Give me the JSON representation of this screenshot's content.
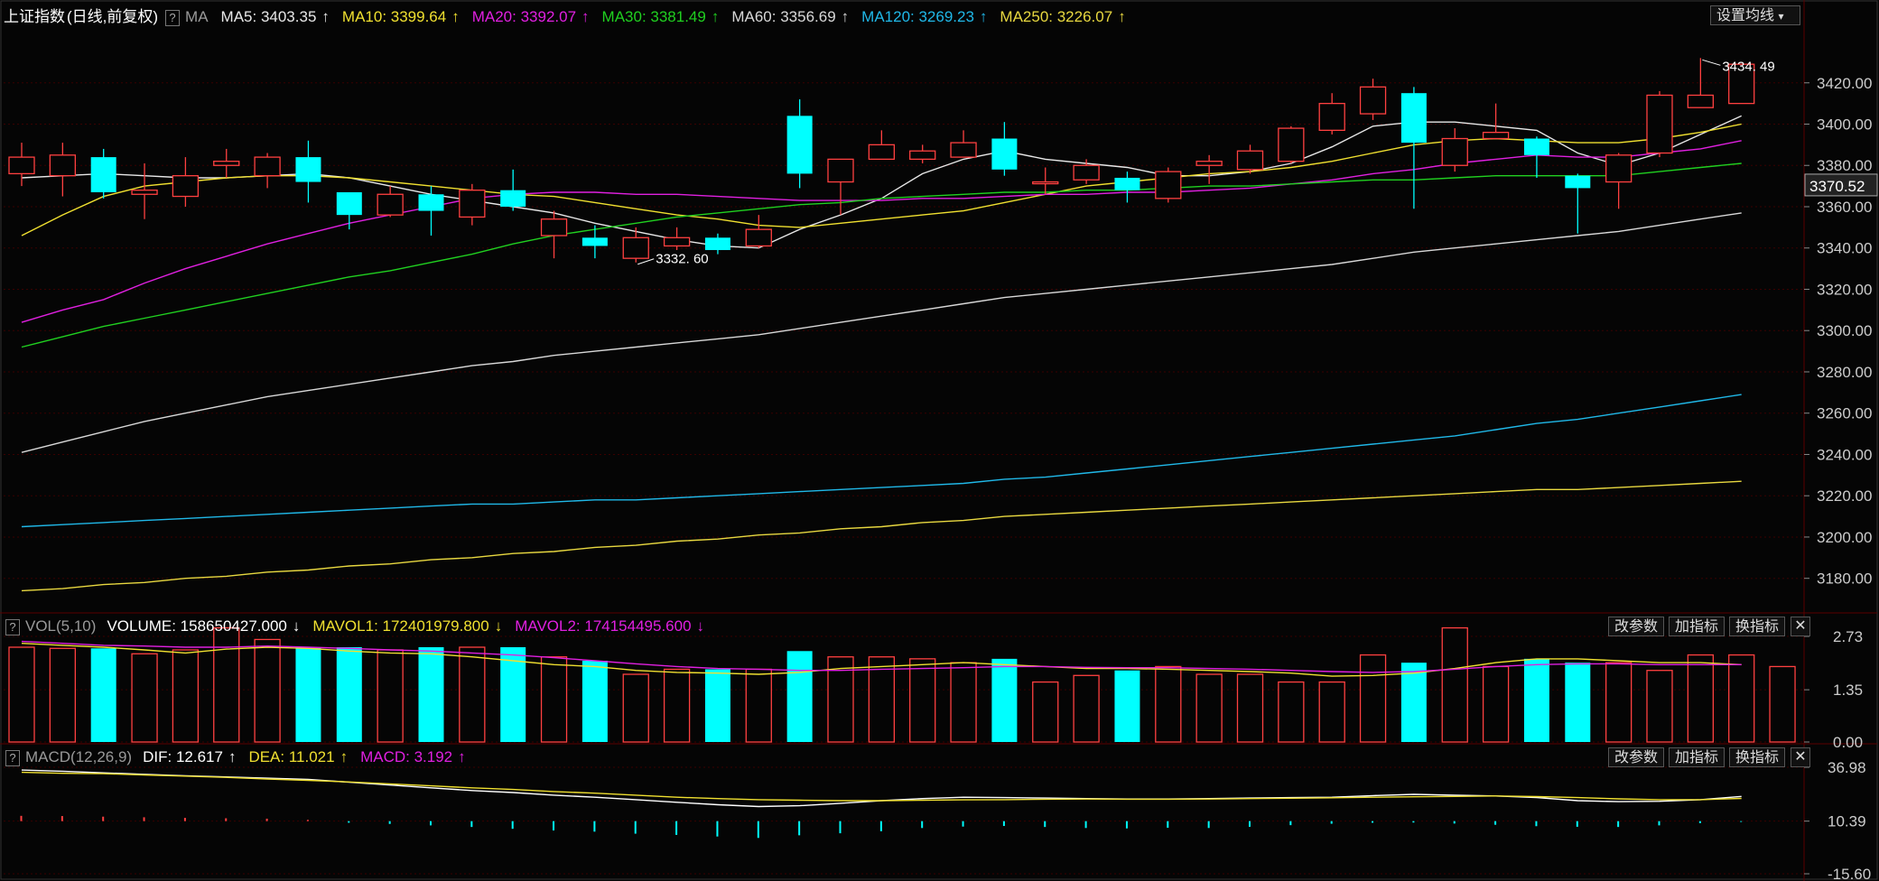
{
  "main_panel": {
    "title": "上证指数",
    "subtitle": "(日线,前复权)",
    "help": "?",
    "indicator": "MA",
    "ma_items": [
      {
        "label": "MA5: 3403.35",
        "arrow": "↑",
        "color": "#e8e8e8"
      },
      {
        "label": "MA10: 3399.64",
        "arrow": "↑",
        "color": "#f0e030"
      },
      {
        "label": "MA20: 3392.07",
        "arrow": "↑",
        "color": "#e020e0"
      },
      {
        "label": "MA30: 3381.49",
        "arrow": "↑",
        "color": "#20d020"
      },
      {
        "label": "MA60: 3356.69",
        "arrow": "↑",
        "color": "#d8d8d8"
      },
      {
        "label": "MA120: 3269.23",
        "arrow": "↑",
        "color": "#20b8e8"
      },
      {
        "label": "MA250: 3226.07",
        "arrow": "↑",
        "color": "#e8d840"
      }
    ],
    "settings_button": "设置均线",
    "settings_caret": "▾",
    "price_ticks": [
      "3420.00",
      "3400.00",
      "3380.00",
      "3360.00",
      "3340.00",
      "3320.00",
      "3300.00",
      "3280.00",
      "3260.00",
      "3240.00",
      "3220.00",
      "3200.00",
      "3180.00"
    ],
    "current_price": "3370.52",
    "high_marker": "3434. 49",
    "low_marker": "3332. 60"
  },
  "volume_panel": {
    "help": "?",
    "indicator": "VOL(5,10)",
    "items": [
      {
        "label": "VOLUME: 158650427.000",
        "arrow": "↓",
        "color": "#ffffff"
      },
      {
        "label": "MAVOL1: 172401979.800",
        "arrow": "↓",
        "color": "#f0e030"
      },
      {
        "label": "MAVOL2: 174154495.600",
        "arrow": "↓",
        "color": "#e020e0"
      }
    ],
    "buttons": [
      "改参数",
      "加指标",
      "换指标"
    ],
    "close": "✕",
    "ticks": [
      "2.73",
      "1.35",
      "0.00"
    ]
  },
  "macd_panel": {
    "help": "?",
    "indicator": "MACD(12,26,9)",
    "items": [
      {
        "label": "DIF: 12.617",
        "arrow": "↑",
        "color": "#ffffff"
      },
      {
        "label": "DEA: 11.021",
        "arrow": "↑",
        "color": "#f0e030"
      },
      {
        "label": "MACD: 3.192",
        "arrow": "↑",
        "color": "#e020e0"
      }
    ],
    "buttons": [
      "改参数",
      "加指标",
      "换指标"
    ],
    "close": "✕",
    "ticks": [
      "36.98",
      "10.39",
      "-15.60"
    ]
  },
  "colors": {
    "up": "#ff4040",
    "down": "#00ffff",
    "grid": "#3a0000"
  },
  "chart_data": [
    {
      "type": "candlestick",
      "price_range": [
        3165,
        3447
      ],
      "candles": [
        {
          "o": 3376,
          "c": 3384,
          "h": 3391,
          "l": 3370
        },
        {
          "o": 3375,
          "c": 3385,
          "h": 3391,
          "l": 3365
        },
        {
          "o": 3384,
          "c": 3367,
          "h": 3388,
          "l": 3364
        },
        {
          "o": 3366,
          "c": 3368,
          "h": 3381,
          "l": 3354
        },
        {
          "o": 3365,
          "c": 3375,
          "h": 3384,
          "l": 3360
        },
        {
          "o": 3380,
          "c": 3382,
          "h": 3388,
          "l": 3374
        },
        {
          "o": 3375,
          "c": 3384,
          "h": 3386,
          "l": 3369
        },
        {
          "o": 3384,
          "c": 3372,
          "h": 3392,
          "l": 3362
        },
        {
          "o": 3367,
          "c": 3356,
          "h": 3367,
          "l": 3349
        },
        {
          "o": 3356,
          "c": 3366,
          "h": 3370,
          "l": 3355
        },
        {
          "o": 3366,
          "c": 3358,
          "h": 3370,
          "l": 3346
        },
        {
          "o": 3355,
          "c": 3368,
          "h": 3371,
          "l": 3351
        },
        {
          "o": 3368,
          "c": 3360,
          "h": 3378,
          "l": 3358
        },
        {
          "o": 3346,
          "c": 3354,
          "h": 3358,
          "l": 3335
        },
        {
          "o": 3345,
          "c": 3341,
          "h": 3351,
          "l": 3335
        },
        {
          "o": 3335,
          "c": 3345,
          "h": 3350,
          "l": 3333
        },
        {
          "o": 3341,
          "c": 3345,
          "h": 3350,
          "l": 3339
        },
        {
          "o": 3345,
          "c": 3339,
          "h": 3347,
          "l": 3337
        },
        {
          "o": 3341,
          "c": 3349,
          "h": 3356,
          "l": 3340
        },
        {
          "o": 3404,
          "c": 3376,
          "h": 3412,
          "l": 3369
        },
        {
          "o": 3372,
          "c": 3383,
          "h": 3383,
          "l": 3356
        },
        {
          "o": 3383,
          "c": 3390,
          "h": 3397,
          "l": 3383
        },
        {
          "o": 3383,
          "c": 3387,
          "h": 3390,
          "l": 3381
        },
        {
          "o": 3384,
          "c": 3391,
          "h": 3397,
          "l": 3384
        },
        {
          "o": 3393,
          "c": 3378,
          "h": 3401,
          "l": 3375
        },
        {
          "o": 3372,
          "c": 3372,
          "h": 3379,
          "l": 3366
        },
        {
          "o": 3373,
          "c": 3380,
          "h": 3383,
          "l": 3371
        },
        {
          "o": 3374,
          "c": 3368,
          "h": 3377,
          "l": 3362
        },
        {
          "o": 3364,
          "c": 3377,
          "h": 3379,
          "l": 3362
        },
        {
          "o": 3380,
          "c": 3382,
          "h": 3385,
          "l": 3371
        },
        {
          "o": 3378,
          "c": 3387,
          "h": 3390,
          "l": 3376
        },
        {
          "o": 3382,
          "c": 3398,
          "h": 3399,
          "l": 3381
        },
        {
          "o": 3397,
          "c": 3410,
          "h": 3415,
          "l": 3395
        },
        {
          "o": 3405,
          "c": 3418,
          "h": 3422,
          "l": 3402
        },
        {
          "o": 3415,
          "c": 3391,
          "h": 3418,
          "l": 3359
        },
        {
          "o": 3380,
          "c": 3393,
          "h": 3398,
          "l": 3377
        },
        {
          "o": 3393,
          "c": 3396,
          "h": 3410,
          "l": 3393
        },
        {
          "o": 3393,
          "c": 3385,
          "h": 3394,
          "l": 3374
        },
        {
          "o": 3375,
          "c": 3369,
          "h": 3376,
          "l": 3347
        },
        {
          "o": 3372,
          "c": 3385,
          "h": 3386,
          "l": 3359
        },
        {
          "o": 3386,
          "c": 3414,
          "h": 3416,
          "l": 3384
        },
        {
          "o": 3408,
          "c": 3414,
          "h": 3432,
          "l": 3408
        },
        {
          "o": 3410,
          "c": 3429,
          "h": 3429,
          "l": 3410
        }
      ],
      "ma_lines": [
        {
          "name": "MA5",
          "color": "#e8e8e8",
          "values": [
            3374,
            3375,
            3376,
            3375,
            3374,
            3374,
            3375,
            3376,
            3374,
            3370,
            3366,
            3363,
            3360,
            3357,
            3352,
            3348,
            3344,
            3341,
            3340,
            3349,
            3356,
            3364,
            3376,
            3383,
            3387,
            3383,
            3381,
            3379,
            3375,
            3375,
            3377,
            3381,
            3389,
            3399,
            3401,
            3401,
            3399,
            3397,
            3386,
            3380,
            3386,
            3395,
            3404
          ]
        },
        {
          "name": "MA10",
          "color": "#f0e030",
          "values": [
            3346,
            3356,
            3365,
            3370,
            3372,
            3374,
            3375,
            3375,
            3374,
            3372,
            3370,
            3368,
            3366,
            3365,
            3362,
            3359,
            3356,
            3354,
            3351,
            3350,
            3352,
            3354,
            3356,
            3358,
            3362,
            3366,
            3370,
            3372,
            3374,
            3376,
            3377,
            3379,
            3382,
            3386,
            3390,
            3392,
            3393,
            3392,
            3391,
            3391,
            3393,
            3396,
            3400
          ]
        },
        {
          "name": "MA20",
          "color": "#e020e0",
          "values": [
            3304,
            3310,
            3315,
            3323,
            3330,
            3336,
            3342,
            3347,
            3352,
            3356,
            3360,
            3364,
            3366,
            3367,
            3367,
            3366,
            3366,
            3365,
            3364,
            3363,
            3363,
            3363,
            3364,
            3364,
            3365,
            3366,
            3366,
            3367,
            3367,
            3368,
            3369,
            3371,
            3373,
            3376,
            3378,
            3381,
            3383,
            3385,
            3384,
            3384,
            3386,
            3388,
            3392
          ]
        },
        {
          "name": "MA30",
          "color": "#20d020",
          "values": [
            3292,
            3297,
            3302,
            3306,
            3310,
            3314,
            3318,
            3322,
            3326,
            3329,
            3333,
            3337,
            3342,
            3346,
            3349,
            3352,
            3355,
            3357,
            3359,
            3361,
            3362,
            3364,
            3365,
            3366,
            3367,
            3367,
            3368,
            3368,
            3369,
            3370,
            3370,
            3371,
            3372,
            3373,
            3373,
            3374,
            3375,
            3375,
            3375,
            3375,
            3377,
            3379,
            3381
          ]
        },
        {
          "name": "MA60",
          "color": "#d8d8d8",
          "values": [
            3241,
            3246,
            3251,
            3256,
            3260,
            3264,
            3268,
            3271,
            3274,
            3277,
            3280,
            3283,
            3285,
            3288,
            3290,
            3292,
            3294,
            3296,
            3298,
            3301,
            3304,
            3307,
            3310,
            3313,
            3316,
            3318,
            3320,
            3322,
            3324,
            3326,
            3328,
            3330,
            3332,
            3335,
            3338,
            3340,
            3342,
            3344,
            3346,
            3348,
            3351,
            3354,
            3357
          ]
        },
        {
          "name": "MA120",
          "color": "#20b8e8",
          "values": [
            3205,
            3206,
            3207,
            3208,
            3209,
            3210,
            3211,
            3212,
            3213,
            3214,
            3215,
            3216,
            3216,
            3217,
            3218,
            3218,
            3219,
            3220,
            3221,
            3222,
            3223,
            3224,
            3225,
            3226,
            3228,
            3229,
            3231,
            3233,
            3235,
            3237,
            3239,
            3241,
            3243,
            3245,
            3247,
            3249,
            3252,
            3255,
            3257,
            3260,
            3263,
            3266,
            3269
          ]
        },
        {
          "name": "MA250",
          "color": "#e8d840",
          "values": [
            3174,
            3175,
            3177,
            3178,
            3180,
            3181,
            3183,
            3184,
            3186,
            3187,
            3189,
            3190,
            3192,
            3193,
            3195,
            3196,
            3198,
            3199,
            3201,
            3202,
            3204,
            3205,
            3207,
            3208,
            3210,
            3211,
            3212,
            3213,
            3214,
            3215,
            3216,
            3217,
            3218,
            3219,
            3220,
            3221,
            3222,
            3223,
            3223,
            3224,
            3225,
            3226,
            3227
          ]
        }
      ],
      "markers": {
        "high_index": 41,
        "low_index": 15
      }
    },
    {
      "type": "bar",
      "name": "VOL(5,10)",
      "ylim": [
        0,
        2.73
      ],
      "values": [
        2.45,
        2.42,
        2.42,
        2.28,
        2.38,
        2.95,
        2.65,
        2.45,
        2.45,
        2.38,
        2.45,
        2.45,
        2.45,
        2.2,
        2.1,
        1.75,
        1.88,
        1.88,
        1.88,
        2.35,
        2.2,
        2.2,
        2.15,
        2.05,
        2.15,
        1.55,
        1.72,
        1.85,
        1.95,
        1.75,
        1.75,
        1.55,
        1.55,
        2.25,
        2.05,
        2.95,
        1.95,
        2.15,
        2.05,
        2.05,
        1.85,
        2.25,
        2.25,
        1.95
      ],
      "mavol1": [
        2.55,
        2.5,
        2.45,
        2.38,
        2.3,
        2.4,
        2.45,
        2.42,
        2.35,
        2.3,
        2.28,
        2.2,
        2.1,
        2.0,
        1.95,
        1.85,
        1.8,
        1.78,
        1.75,
        1.8,
        1.9,
        1.95,
        2.0,
        2.05,
        2.0,
        1.95,
        1.9,
        1.9,
        1.88,
        1.85,
        1.82,
        1.78,
        1.7,
        1.72,
        1.78,
        1.9,
        2.05,
        2.15,
        2.15,
        2.1,
        2.05,
        2.05,
        2.0
      ],
      "mavol2": [
        2.6,
        2.55,
        2.5,
        2.48,
        2.45,
        2.45,
        2.48,
        2.45,
        2.42,
        2.38,
        2.35,
        2.3,
        2.25,
        2.18,
        2.1,
        2.02,
        1.95,
        1.9,
        1.88,
        1.85,
        1.85,
        1.88,
        1.9,
        1.92,
        1.95,
        1.95,
        1.93,
        1.92,
        1.92,
        1.9,
        1.88,
        1.85,
        1.82,
        1.8,
        1.82,
        1.88,
        1.95,
        2.0,
        2.02,
        2.02,
        2.0,
        2.0,
        2.0
      ]
    },
    {
      "type": "bar",
      "name": "MACD(12,26,9)",
      "ylim": [
        -15.6,
        36.98
      ],
      "zero": 10.39,
      "macd": [
        13.0,
        12.9,
        12.6,
        12.3,
        12.0,
        11.8,
        11.6,
        11.0,
        9.6,
        9.0,
        8.3,
        7.5,
        6.6,
        5.8,
        5.2,
        4.2,
        3.6,
        2.8,
        2.1,
        3.4,
        4.4,
        5.4,
        7.0,
        7.7,
        8.0,
        7.5,
        7.0,
        6.8,
        7.1,
        7.0,
        7.6,
        8.4,
        9.1,
        9.6,
        9.7,
        9.2,
        8.6,
        7.9,
        7.6,
        7.5,
        8.3,
        9.4,
        10.0
      ],
      "dif": [
        35.6,
        35.0,
        34.2,
        33.5,
        32.8,
        32.2,
        31.6,
        31.0,
        29.6,
        28.2,
        26.8,
        25.5,
        24.5,
        23.2,
        22.2,
        21.0,
        19.7,
        18.5,
        17.6,
        18.0,
        19.2,
        20.5,
        21.5,
        22.2,
        22.0,
        21.8,
        21.5,
        21.3,
        21.3,
        21.5,
        21.8,
        22.0,
        22.2,
        23.0,
        23.6,
        23.2,
        22.8,
        22.0,
        20.5,
        20.0,
        20.2,
        21.0,
        22.6
      ],
      "dea": [
        34.5,
        34.0,
        33.8,
        33.2,
        32.6,
        32.0,
        31.2,
        30.5,
        29.7,
        28.8,
        27.8,
        26.8,
        26.0,
        25.0,
        24.2,
        23.2,
        22.2,
        21.5,
        21.0,
        20.7,
        20.5,
        20.5,
        20.7,
        20.9,
        21.0,
        21.2,
        21.3,
        21.2,
        21.2,
        21.3,
        21.5,
        21.7,
        21.9,
        22.2,
        22.4,
        22.6,
        22.8,
        22.5,
        22.0,
        21.4,
        21.0,
        21.0,
        21.6
      ]
    }
  ]
}
